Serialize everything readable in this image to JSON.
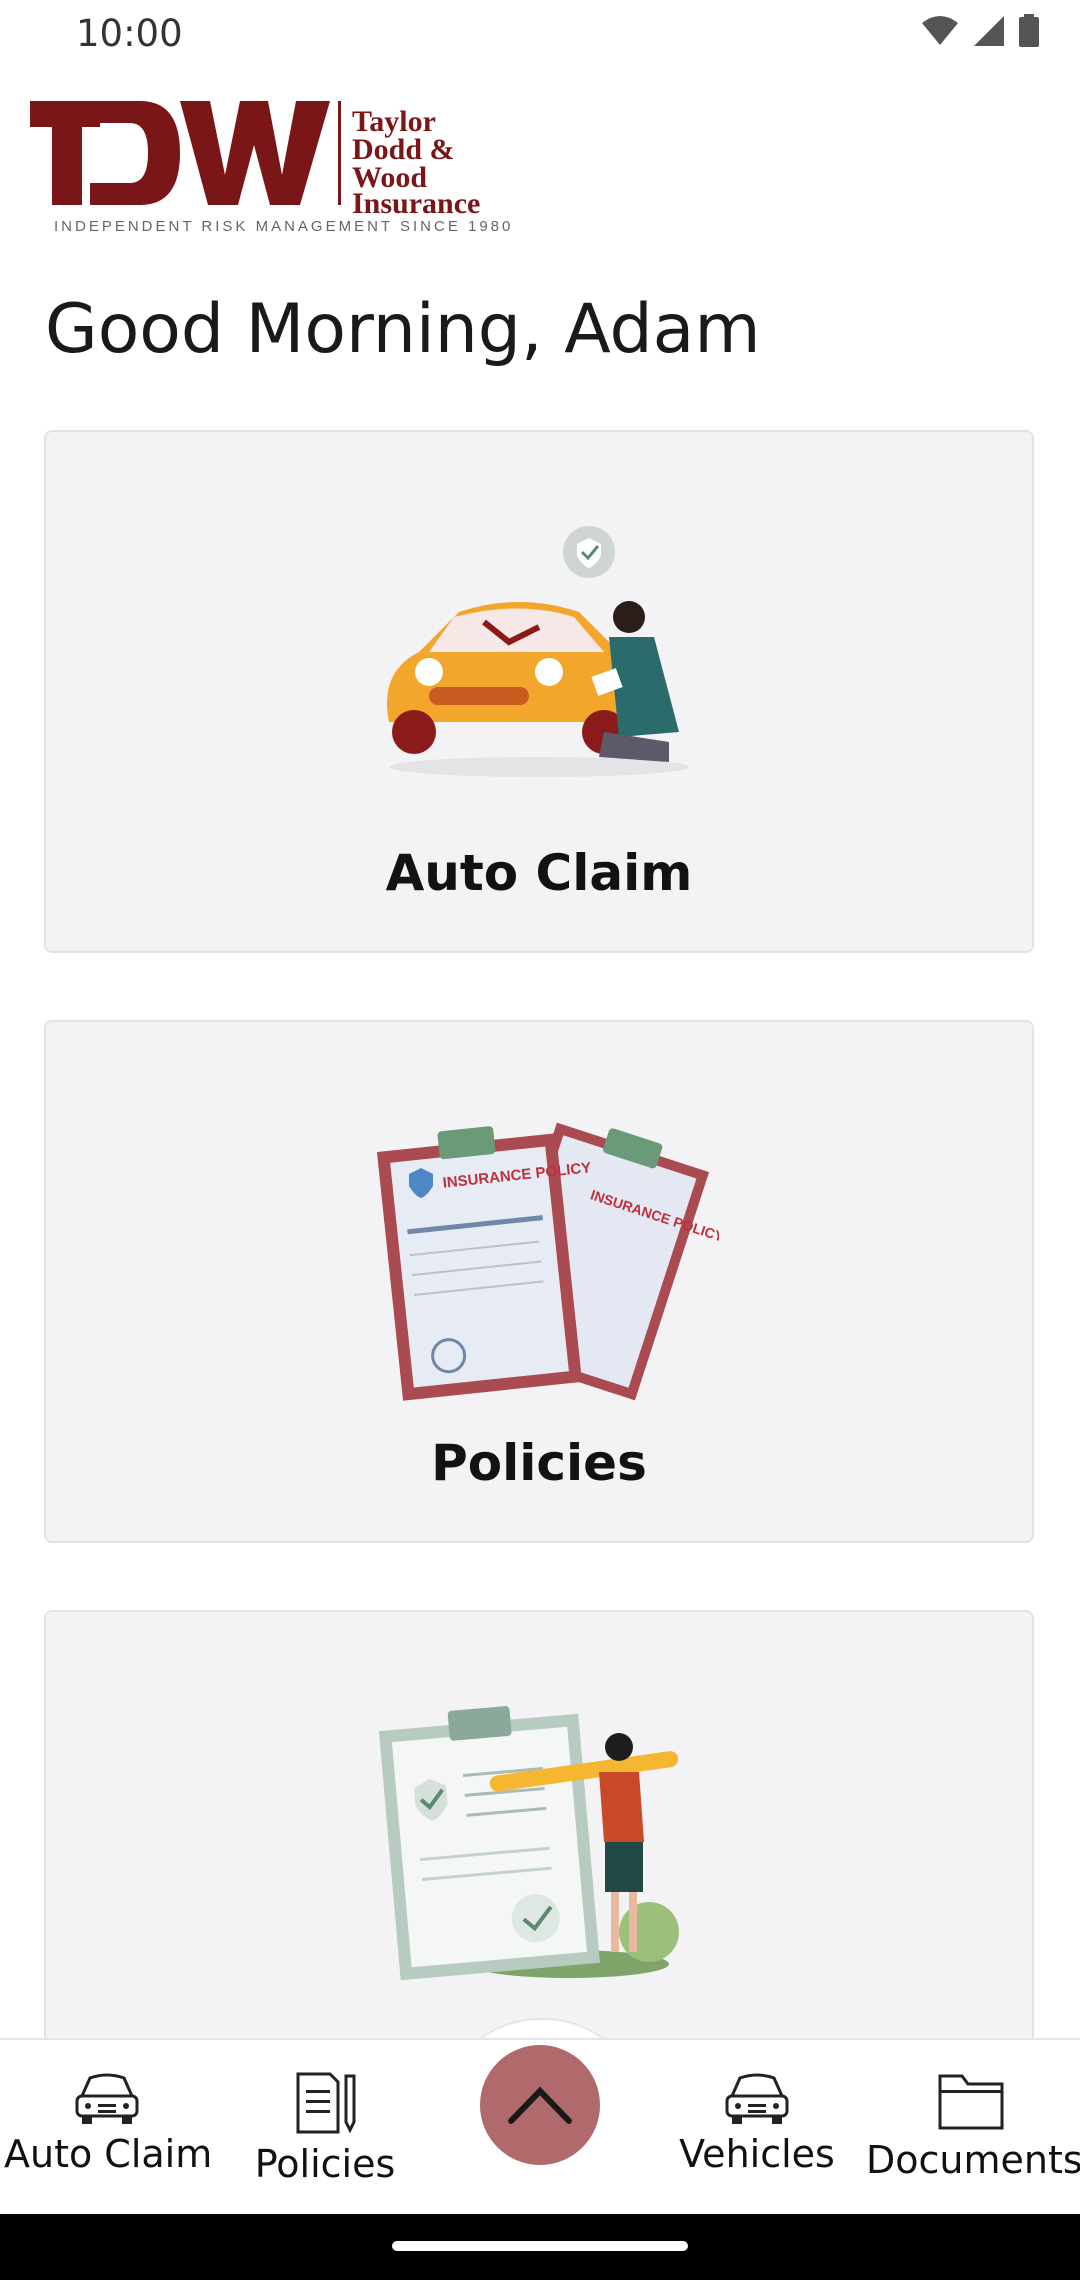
{
  "status": {
    "time": "10:00"
  },
  "logo": {
    "monogram": "TDW",
    "name_line1": "Taylor",
    "name_line2": "Dodd &",
    "name_line3": "Wood",
    "name_line4": "Insurance",
    "tagline": "INDEPENDENT RISK MANAGEMENT SINCE 1980",
    "brand_color": "#7a1518"
  },
  "greeting": "Good Morning, Adam",
  "cards": [
    {
      "title": "Auto Claim",
      "icon": "car-inspection-illustration"
    },
    {
      "title": "Policies",
      "icon": "insurance-policy-illustration"
    },
    {
      "title": "",
      "icon": "checklist-illustration"
    }
  ],
  "illustration_text": {
    "policy_doc": "INSURANCE POLICY"
  },
  "bottom_nav": {
    "items": [
      {
        "label": "Auto Claim",
        "icon": "car-icon"
      },
      {
        "label": "Policies",
        "icon": "policies-icon"
      },
      {
        "label": "Vehicles",
        "icon": "car-icon"
      },
      {
        "label": "Documents",
        "icon": "folder-icon"
      }
    ],
    "fab_icon": "chevron-up-icon",
    "fab_color": "#b06a6c"
  }
}
